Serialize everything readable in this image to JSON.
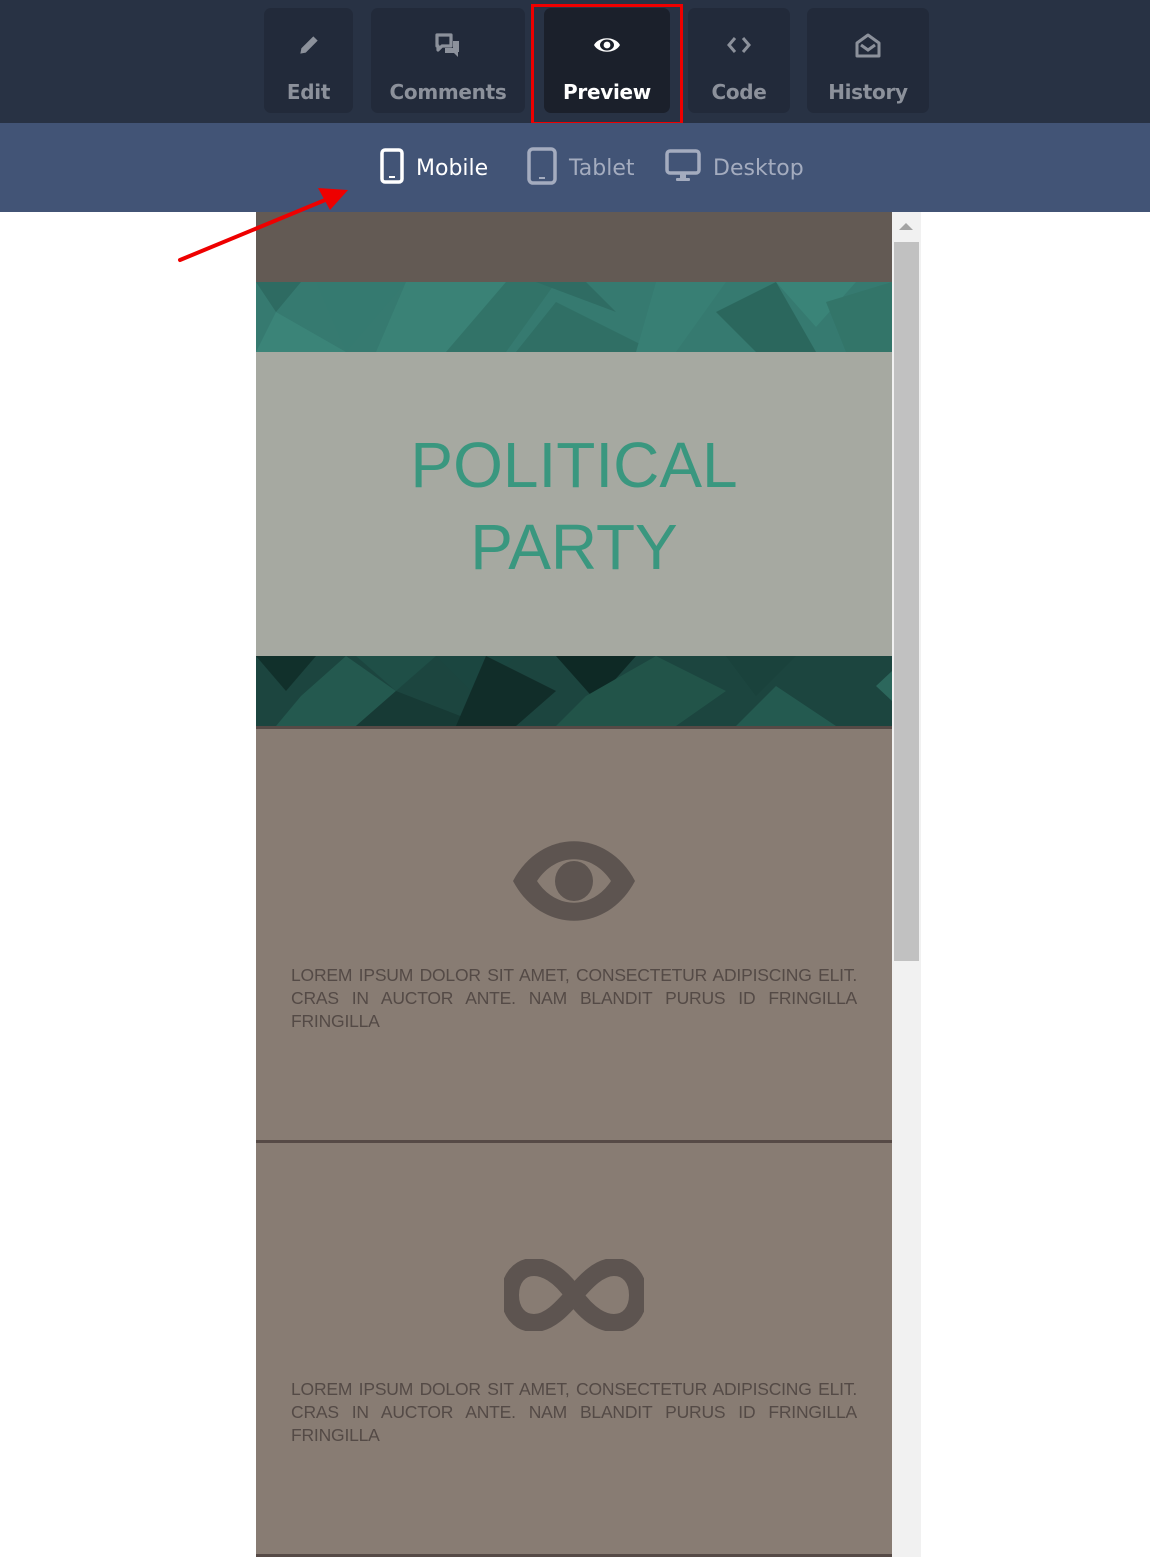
{
  "toolbar": {
    "tabs": [
      {
        "id": "edit",
        "label": "Edit",
        "icon": "pencil-icon",
        "active": false
      },
      {
        "id": "comments",
        "label": "Comments",
        "icon": "comments-icon",
        "active": false
      },
      {
        "id": "preview",
        "label": "Preview",
        "icon": "eye-icon",
        "active": true
      },
      {
        "id": "code",
        "label": "Code",
        "icon": "code-icon",
        "active": false
      },
      {
        "id": "history",
        "label": "History",
        "icon": "envelope-open-icon",
        "active": false
      }
    ],
    "highlight_color": "#ee0000"
  },
  "device_bar": {
    "devices": [
      {
        "id": "mobile",
        "label": "Mobile",
        "icon": "mobile-icon",
        "active": true
      },
      {
        "id": "tablet",
        "label": "Tablet",
        "icon": "tablet-icon",
        "active": false
      },
      {
        "id": "desktop",
        "label": "Desktop",
        "icon": "desktop-icon",
        "active": false
      }
    ]
  },
  "annotation": {
    "type": "arrow",
    "color": "#ee0000",
    "points_to": "mobile"
  },
  "preview": {
    "hero": {
      "title_line1": "POLITICAL",
      "title_line2": "PARTY",
      "title_color": "#3a977f"
    },
    "features": [
      {
        "icon": "eye-icon",
        "text": "LOREM IPSUM DOLOR SIT AMET, CONSECTETUR ADIPISCING ELIT. CRAS IN AUCTOR ANTE. NAM BLANDIT PURUS ID FRINGILLA FRINGILLA"
      },
      {
        "icon": "infinity-icon",
        "text": "LOREM IPSUM DOLOR SIT AMET, CONSECTETUR ADIPISCING ELIT. CRAS IN AUCTOR ANTE. NAM BLANDIT PURUS ID FRINGILLA FRINGILLA"
      }
    ],
    "colors": {
      "top_strip": "#635a54",
      "band_light": "#367a70",
      "band_dark": "#1c453f",
      "hero_bg": "#a6a9a1",
      "feature_bg": "#887c73",
      "feature_text": "#544a46"
    }
  }
}
